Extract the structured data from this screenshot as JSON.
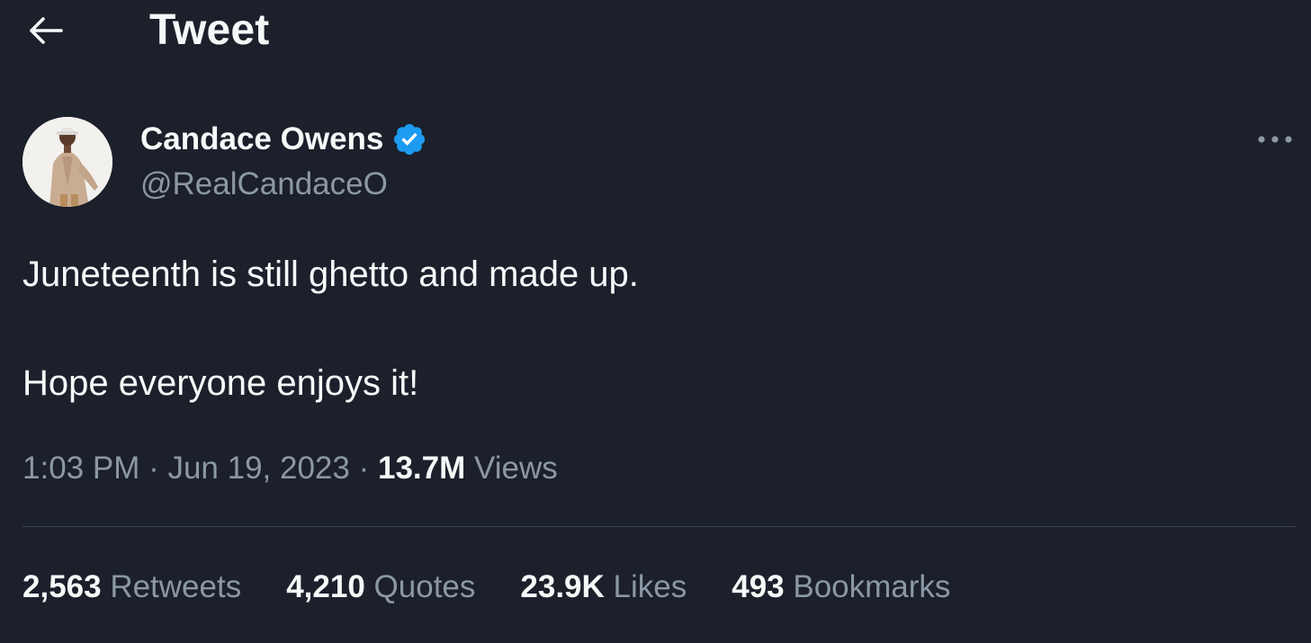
{
  "header": {
    "back_icon": "arrow-left-icon",
    "title": "Tweet"
  },
  "author": {
    "display_name": "Candace Owens",
    "handle": "@RealCandaceO",
    "verified_icon": "verified-badge-icon",
    "verified_color": "#1d9bf0",
    "avatar_icon": "avatar-photo"
  },
  "more_icon": "more-horizontal-icon",
  "tweet": {
    "line1": "Juneteenth is still ghetto and made up.",
    "line2": "Hope everyone enjoys it!"
  },
  "meta": {
    "time": "1:03 PM",
    "sep1": " · ",
    "date": "Jun 19, 2023",
    "sep2": " · ",
    "views_count": "13.7M",
    "views_label": " Views"
  },
  "stats": [
    {
      "count": "2,563",
      "label": " Retweets"
    },
    {
      "count": "4,210",
      "label": " Quotes"
    },
    {
      "count": "23.9K",
      "label": " Likes"
    },
    {
      "count": "493",
      "label": " Bookmarks"
    }
  ],
  "colors": {
    "background": "#1b202b",
    "text_primary": "#f7f9f9",
    "text_secondary": "#8b98a5",
    "divider": "#38444d"
  }
}
